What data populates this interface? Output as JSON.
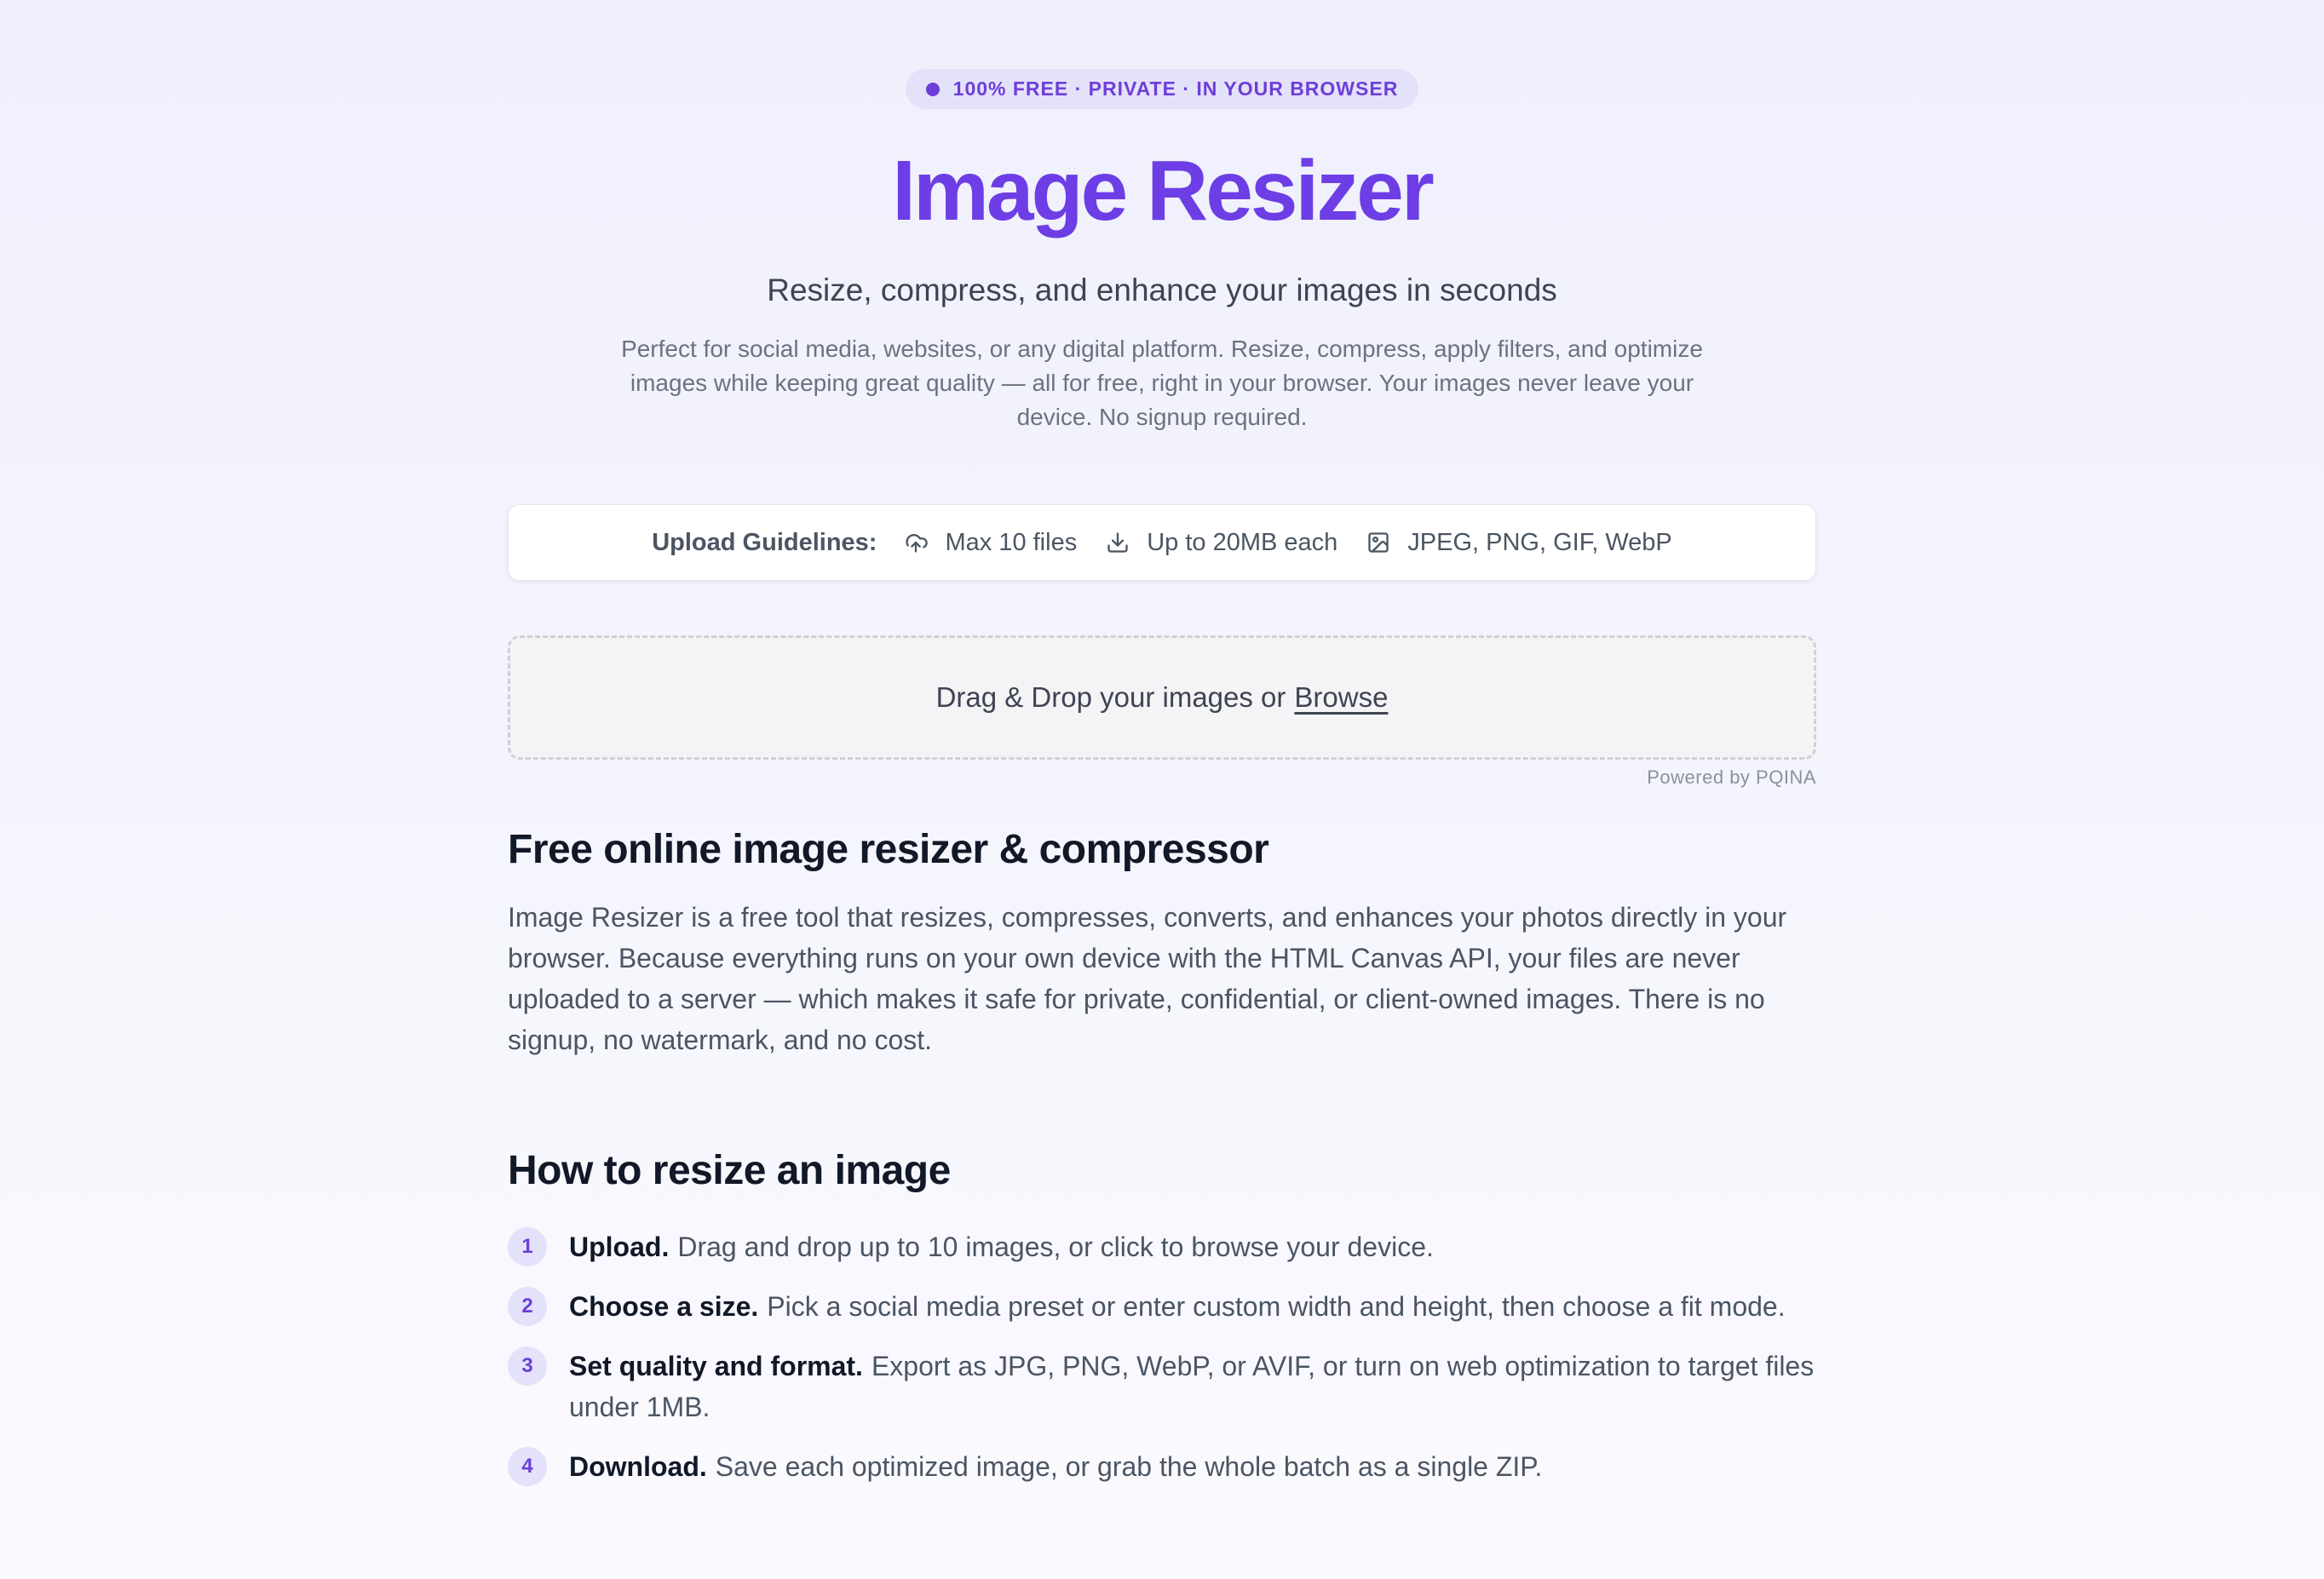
{
  "hero": {
    "badge": "100% FREE · PRIVATE · IN YOUR BROWSER",
    "title": "Image Resizer",
    "subtitle": "Resize, compress, and enhance your images in seconds",
    "description": "Perfect for social media, websites, or any digital platform. Resize, compress, apply filters, and optimize images while keeping great quality — all for free, right in your browser. Your images never leave your device. No signup required."
  },
  "guidelines": {
    "label": "Upload Guidelines:",
    "items": [
      {
        "icon": "cloud-upload-icon",
        "text": "Max 10 files"
      },
      {
        "icon": "download-icon",
        "text": "Up to 20MB each"
      },
      {
        "icon": "image-icon",
        "text": "JPEG, PNG, GIF, WebP"
      }
    ]
  },
  "dropzone": {
    "text": "Drag & Drop your images or",
    "browse_label": "Browse",
    "powered_by": "Powered by PQINA"
  },
  "about": {
    "title": "Free online image resizer & compressor",
    "text": "Image Resizer is a free tool that resizes, compresses, converts, and enhances your photos directly in your browser. Because everything runs on your own device with the HTML Canvas API, your files are never uploaded to a server — which makes it safe for private, confidential, or client-owned images. There is no signup, no watermark, and no cost."
  },
  "howto": {
    "title": "How to resize an image",
    "steps": [
      {
        "num": "1",
        "title": "Upload.",
        "text": "Drag and drop up to 10 images, or click to browse your device."
      },
      {
        "num": "2",
        "title": "Choose a size.",
        "text": "Pick a social media preset or enter custom width and height, then choose a fit mode."
      },
      {
        "num": "3",
        "title": "Set quality and format.",
        "text": "Export as JPG, PNG, WebP, or AVIF, or turn on web optimization to target files under 1MB."
      },
      {
        "num": "4",
        "title": "Download.",
        "text": "Save each optimized image, or grab the whole batch as a single ZIP."
      }
    ]
  },
  "colors": {
    "accent": "#6d3ee5",
    "badge_bg": "#e4e1fb",
    "heading": "#111827",
    "body_text": "#4b5563"
  }
}
